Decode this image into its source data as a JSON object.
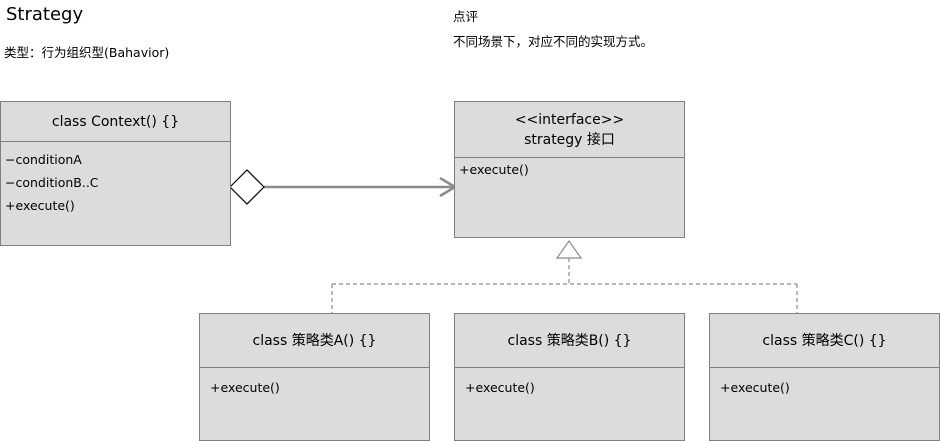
{
  "header": {
    "title": "Strategy",
    "type_line": "类型：行为组织型(Bahavior)"
  },
  "note": {
    "title": "点评",
    "text": "不同场景下，对应不同的实现方式。"
  },
  "context_class": {
    "name": "class Context() {}",
    "members": [
      "−conditionA",
      "−conditionB..C",
      "+execute()"
    ]
  },
  "strategy_interface": {
    "stereotype": "<<interface>>",
    "name": "strategy 接口",
    "members": [
      "+execute()"
    ]
  },
  "concrete_a": {
    "name": "class 策略类A() {}",
    "members": [
      "+execute()"
    ]
  },
  "concrete_b": {
    "name": "class 策略类B() {}",
    "members": [
      "+execute()"
    ]
  },
  "concrete_c": {
    "name": "class 策略类C() {}",
    "members": [
      "+execute()"
    ]
  }
}
